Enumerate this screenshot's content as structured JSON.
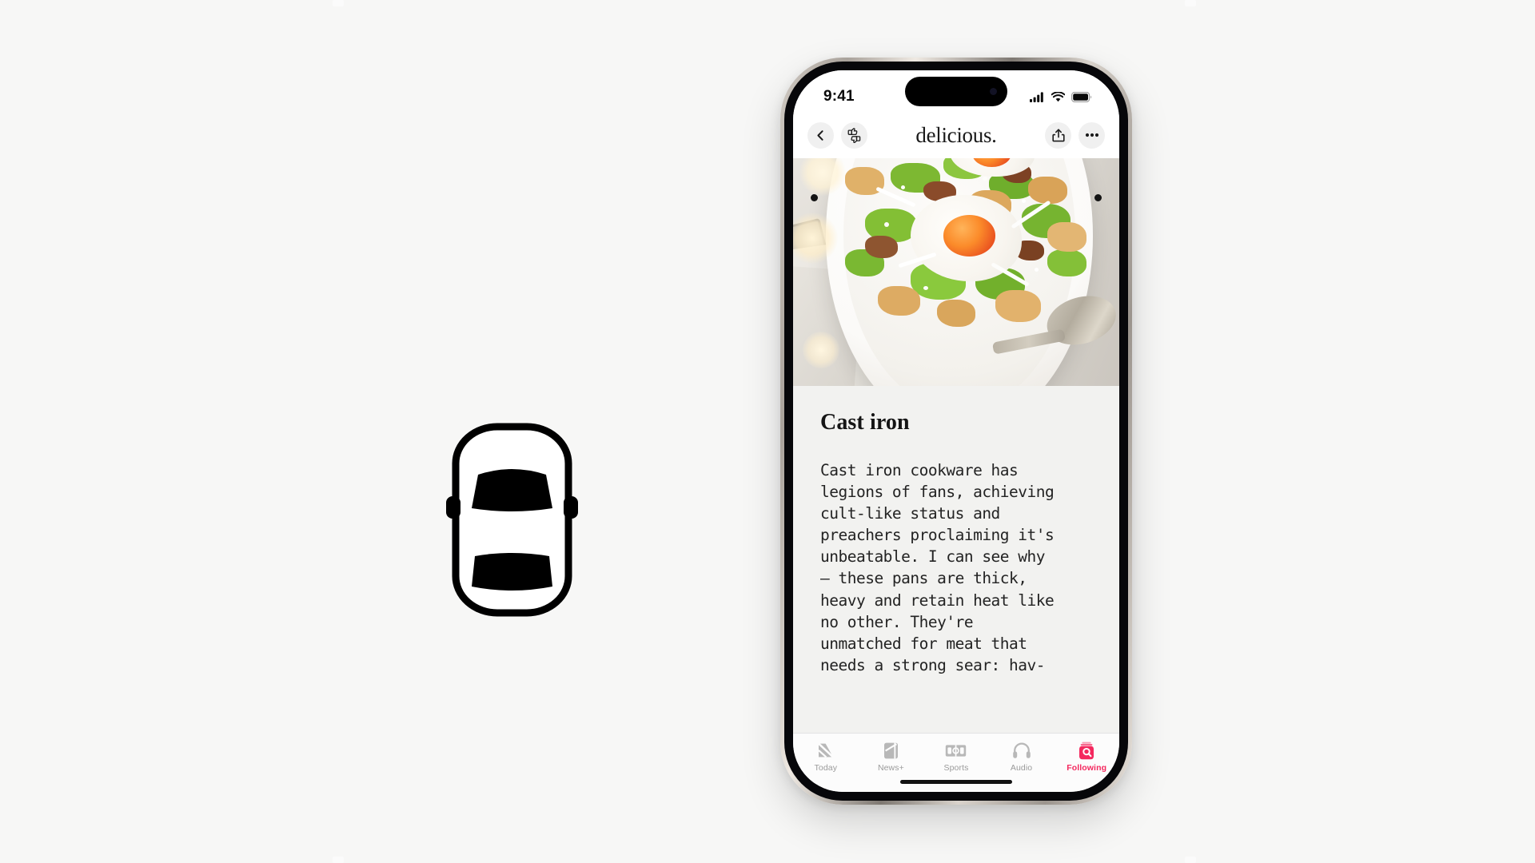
{
  "background": {
    "color": "#f7f7f6"
  },
  "car_glyph": {
    "name": "car-top-view-icon",
    "color": "#000000"
  },
  "phone": {
    "status_bar": {
      "time": "9:41",
      "cellular_icon": "cellular-bars-icon",
      "wifi_icon": "wifi-icon",
      "battery_icon": "battery-icon",
      "dynamic_island": "dynamic-island"
    },
    "nav_bar": {
      "back_icon": "chevron-left-icon",
      "feedback_icon": "thumbs-up-down-icon",
      "title": "delicious.",
      "share_icon": "share-icon",
      "more_icon": "ellipsis-icon"
    },
    "article": {
      "hero_image_alt": "skillet of potatoes, kale and baked eggs",
      "title": "Cast iron",
      "body": "Cast iron cookware has\nlegions of fans, achieving\ncult-like status and\npreachers proclaiming it's\nunbeatable. I can see why\n– these pans are thick,\nheavy and retain heat like\nno other. They're\nunmatched for meat that\nneeds a strong sear: hav-"
    },
    "tab_bar": {
      "active_color": "#f4285e",
      "inactive_color": "#9a9a9a",
      "tabs": [
        {
          "label": "Today",
          "icon": "news-today-icon",
          "active": false
        },
        {
          "label": "News+",
          "icon": "news-plus-icon",
          "active": false
        },
        {
          "label": "Sports",
          "icon": "sports-icon",
          "active": false
        },
        {
          "label": "Audio",
          "icon": "headphones-icon",
          "active": false
        },
        {
          "label": "Following",
          "icon": "following-icon",
          "active": true
        }
      ]
    },
    "home_indicator": "home-indicator"
  }
}
